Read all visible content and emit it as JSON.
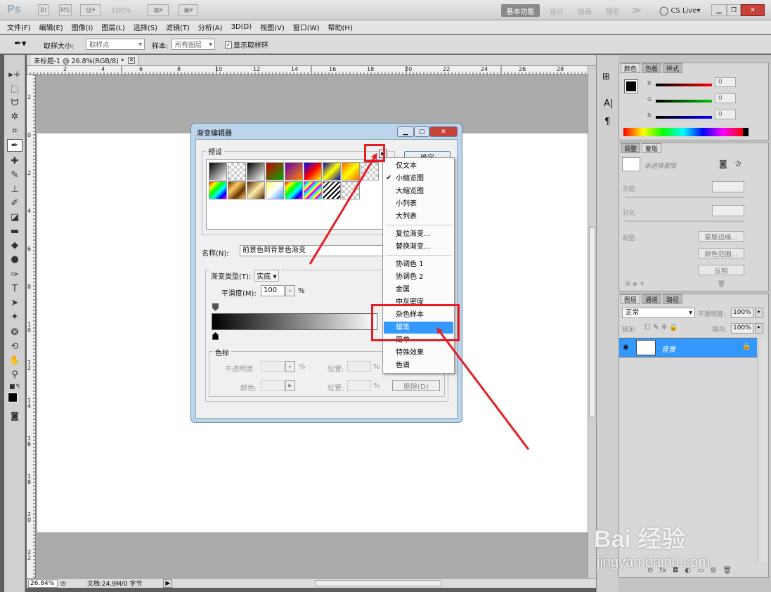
{
  "app": {
    "logo": "Ps",
    "zoom_select": "100%",
    "workspaces": [
      "基本功能",
      "设计",
      "绘画",
      "摄影"
    ],
    "more": "≫",
    "cslive": "CS Live"
  },
  "menu_bar": [
    "文件(F)",
    "编辑(E)",
    "图像(I)",
    "图层(L)",
    "选择(S)",
    "滤镜(T)",
    "分析(A)",
    "3D(D)",
    "视图(V)",
    "窗口(W)",
    "帮助(H)"
  ],
  "options_bar": {
    "sample_size_label": "取样大小:",
    "sample_size_value": "取样点",
    "sample_label": "样本:",
    "sample_value": "所有图层",
    "show_ring_label": "显示取样环"
  },
  "document": {
    "tab_title": "未标题-1 @ 26.8%(RGB/8) *",
    "ruler_h": [
      "2",
      "4",
      "6",
      "8",
      "10",
      "12",
      "14",
      "16",
      "18",
      "20",
      "22",
      "24",
      "26",
      "28"
    ],
    "ruler_v": [
      "2",
      "0",
      "2",
      "4",
      "6",
      "8",
      "1 0",
      "1 2",
      "1 4",
      "1 6",
      "1 8",
      "2 0",
      "2 2"
    ],
    "zoom": "26.84%",
    "doc_info": "文档:24.9M/0 字节"
  },
  "dialog": {
    "title": "渐变编辑器",
    "presets_label": "预设",
    "ok_button": "确定",
    "name_label": "名称(N):",
    "name_value": "前景色到背景色渐变",
    "type_label": "渐变类型(T):",
    "type_value": "实底",
    "smooth_label": "平滑度(M):",
    "smooth_value": "100",
    "smooth_unit": "%",
    "stops_label": "色标",
    "opacity_label": "不透明度:",
    "position_label": "位置:",
    "color_label": "颜色:",
    "percent": "%",
    "delete_button": "删除(D)"
  },
  "preset_menu": {
    "items": [
      "仅文本",
      "小缩览图",
      "大缩览图",
      "小列表",
      "大列表",
      "复位渐变...",
      "替换渐变...",
      "协调色 1",
      "协调色 2",
      "金属",
      "中灰密度",
      "杂色样本",
      "蜡笔",
      "简单",
      "特殊效果",
      "色谱"
    ],
    "checked": "小缩览图",
    "highlighted": "蜡笔"
  },
  "color_panel": {
    "tabs": [
      "颜色",
      "色板",
      "样式"
    ],
    "r_label": "R",
    "g_label": "G",
    "b_label": "B",
    "r_value": "0",
    "g_value": "0",
    "b_value": "0"
  },
  "masks_panel": {
    "tabs": [
      "调整",
      "蒙版"
    ],
    "no_mask_label": "未选择蒙版",
    "density_label": "浓度:",
    "feather_label": "羽化:",
    "refine_label": "调整:",
    "mask_edge_button": "蒙版边缘...",
    "color_range_button": "颜色范围...",
    "invert_button": "反相"
  },
  "layers_panel": {
    "tabs": [
      "图层",
      "通道",
      "路径"
    ],
    "blend_mode": "正常",
    "opacity_label": "不透明度:",
    "opacity_value": "100%",
    "lock_label": "锁定:",
    "fill_label": "填充:",
    "fill_value": "100%",
    "layer_name": "背景"
  },
  "watermark": {
    "brand": "Bai 经验",
    "url": "jingyan.baidu.com"
  },
  "colors": {
    "highlight": "#3399ff",
    "annotation_red": "#e61d24",
    "panel_bg": "#d8d8d8"
  }
}
